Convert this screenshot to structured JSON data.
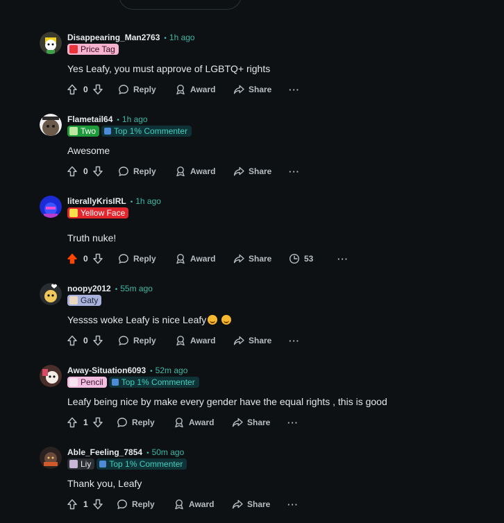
{
  "action_labels": {
    "reply": "Reply",
    "award": "Award",
    "share": "Share",
    "more": "···"
  },
  "separator": "•",
  "comments": [
    {
      "username": "Disappearing_Man2763",
      "time": "1h ago",
      "badges": [
        {
          "label": "Price Tag",
          "style": "pink",
          "icon": "price-tag-icon"
        }
      ],
      "text": "Yes Leafy, you must approve of LGBTQ+ rights",
      "votes": "0",
      "upvoted": false
    },
    {
      "username": "Flametail64",
      "time": "1h ago",
      "badges": [
        {
          "label": "Two",
          "style": "green",
          "icon": "two-icon"
        },
        {
          "label": "Top 1% Commenter",
          "style": "top",
          "icon": "top-commenter-icon"
        }
      ],
      "text": "Awesome",
      "votes": "0",
      "upvoted": false
    },
    {
      "username": "literallyKrisIRL",
      "time": "1h ago",
      "badges": [
        {
          "label": "Yellow Face",
          "style": "red",
          "icon": "yellow-face-icon"
        }
      ],
      "text": "Truth nuke!",
      "votes": "0",
      "upvoted": true,
      "stat": "53"
    },
    {
      "username": "noopy2012",
      "time": "55m ago",
      "badges": [
        {
          "label": "Gaty",
          "style": "lav",
          "icon": "gaty-icon"
        }
      ],
      "text": "Yessss woke Leafy is nice Leafy",
      "votes": "0",
      "upvoted": false
    },
    {
      "username": "Away-Situation6093",
      "time": "52m ago",
      "badges": [
        {
          "label": "Pencil",
          "style": "lpink",
          "icon": "pencil-icon"
        },
        {
          "label": "Top 1% Commenter",
          "style": "top",
          "icon": "top-commenter-icon"
        }
      ],
      "text": "Leafy being nice by make every gender have the equal rights , this is good",
      "votes": "1",
      "upvoted": false
    },
    {
      "username": "Able_Feeling_7854",
      "time": "50m ago",
      "badges": [
        {
          "label": "Liy",
          "style": "dark",
          "icon": "liy-icon"
        },
        {
          "label": "Top 1% Commenter",
          "style": "top",
          "icon": "top-commenter-icon"
        }
      ],
      "text": "Thank you, Leafy",
      "votes": "1",
      "upvoted": false
    }
  ],
  "colors": {
    "background": "#0e1113",
    "accent_teal": "#3eb8a8",
    "upvote_active": "#ff4500",
    "text": "#e5e8ea"
  }
}
